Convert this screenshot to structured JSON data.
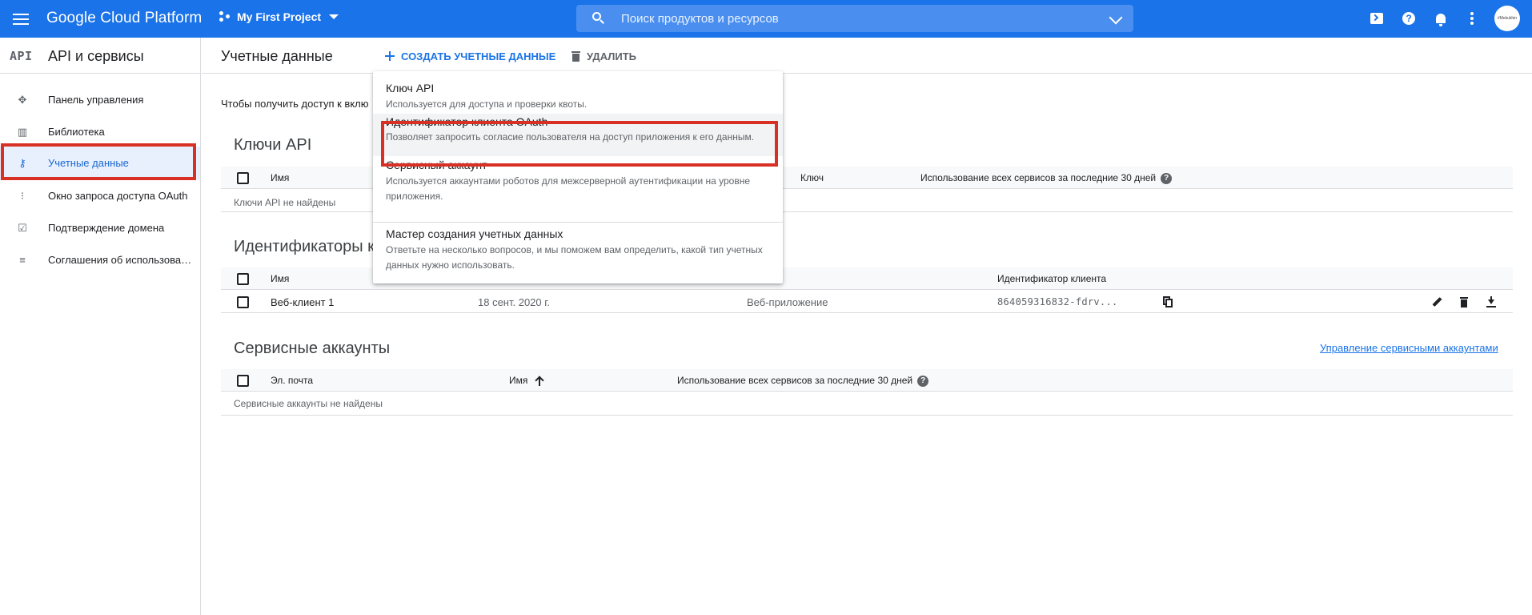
{
  "topbar": {
    "brand": "Google Cloud Platform",
    "project": "My First Project",
    "search_placeholder": "Поиск продуктов и ресурсов",
    "avatar_text": "#Mekukhin"
  },
  "sidebar": {
    "logo": "API",
    "title": "API и сервисы",
    "items": [
      {
        "label": "Панель управления",
        "icon": "dashboard-icon"
      },
      {
        "label": "Библиотека",
        "icon": "library-icon"
      },
      {
        "label": "Учетные данные",
        "icon": "key-icon",
        "active": true
      },
      {
        "label": "Окно запроса доступа OAuth",
        "icon": "consent-icon"
      },
      {
        "label": "Подтверждение домена",
        "icon": "checkbox-icon"
      },
      {
        "label": "Соглашения об использовании страниц",
        "icon": "settings-list-icon"
      }
    ]
  },
  "main": {
    "title": "Учетные данные",
    "create_label": "СОЗДАТЬ УЧЕТНЫЕ ДАННЫЕ",
    "delete_label": "УДАЛИТЬ",
    "info_text": "Чтобы получить доступ к вклю",
    "api_keys": {
      "title": "Ключи API",
      "columns": [
        "Имя",
        "Ключ",
        "Использование всех сервисов за последние 30 дней"
      ],
      "empty": "Ключи API не найдены"
    },
    "oauth": {
      "title": "Идентификаторы к",
      "columns": [
        "Имя",
        "Идентификатор клиента"
      ],
      "rows": [
        {
          "name": "Веб-клиент 1",
          "date": "18 сент. 2020 г.",
          "type": "Веб-приложение",
          "client_id": "864059316832-fdrv..."
        }
      ]
    },
    "service_accounts": {
      "title": "Сервисные аккаунты",
      "manage_link": "Управление сервисными аккаунтами",
      "columns": [
        "Эл. почта",
        "Имя",
        "Использование всех сервисов за последние 30 дней"
      ],
      "empty": "Сервисные аккаунты не найдены"
    }
  },
  "menu": {
    "items": [
      {
        "title": "Ключ API",
        "desc": "Используется для доступа и проверки квоты."
      },
      {
        "title": "Идентификатор клиента OAuth",
        "desc": "Позволяет запросить согласие пользователя на доступ приложения к его данным."
      },
      {
        "title": "Сервисный аккаунт",
        "desc": "Используется аккаунтами роботов для межсерверной аутентификации на уровне приложения."
      },
      {
        "title": "Мастер создания учетных данных",
        "desc": "Ответьте на несколько вопросов, и мы поможем вам определить, какой тип учетных данных нужно использовать."
      }
    ]
  },
  "colors": {
    "topbar": "#1a73e8",
    "highlight": "#d93025",
    "link": "#1a73e8"
  }
}
